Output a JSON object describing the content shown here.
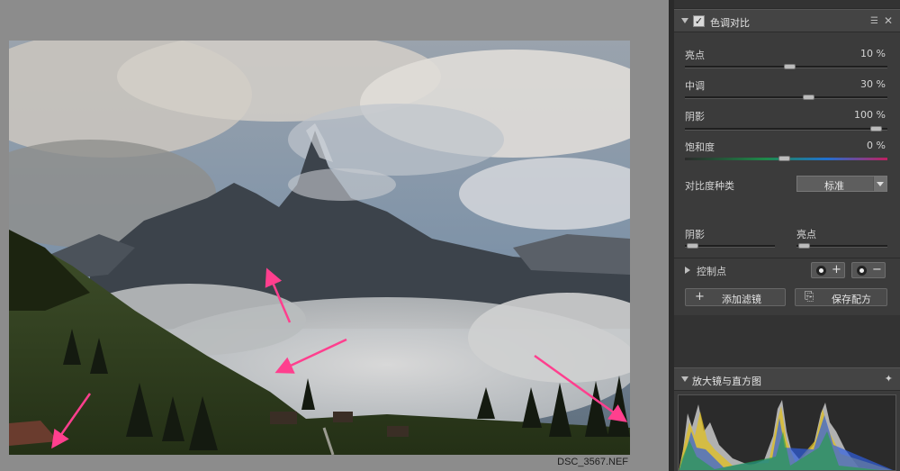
{
  "photo": {
    "filename": "DSC_3567.NEF"
  },
  "tone_panel": {
    "title": "色调对比",
    "checked": true,
    "checkmark": "✓",
    "menu_icon": "☰",
    "close_icon": "✕",
    "rows": [
      {
        "label": "亮点",
        "value": "10 %",
        "level": 0.52
      },
      {
        "label": "中调",
        "value": "30 %",
        "level": 0.62
      },
      {
        "label": "阴影",
        "value": "100 %",
        "level": 0.97
      }
    ],
    "saturation": {
      "label": "饱和度",
      "value": "0 %",
      "level": 0.49
    },
    "contrast_type": {
      "label": "对比度种类",
      "selected": "标准"
    },
    "shadow_protect": {
      "label": "阴影",
      "level": 0.02
    },
    "highlight_protect": {
      "label": "亮点",
      "level": 0.02
    },
    "control_points": {
      "label": "控制点",
      "add_symbol": "+",
      "remove_symbol": "−"
    },
    "buttons": {
      "add_filter_icon": "+",
      "add_filter": "添加滤镜",
      "save_preset_icon": "⎘",
      "save_preset": "保存配方"
    }
  },
  "loupe_panel": {
    "title": "放大镜与直方图",
    "pin_icon": "✦"
  },
  "icons": {
    "section_toggle": "triangle-down-icon",
    "control_point": "control-point-icon",
    "pin": "pin-icon"
  },
  "colors": {
    "panel_bg": "#3b3b3b",
    "annotation_arrow": "#ff3f8e",
    "saturation_track_end": "#c02060"
  }
}
